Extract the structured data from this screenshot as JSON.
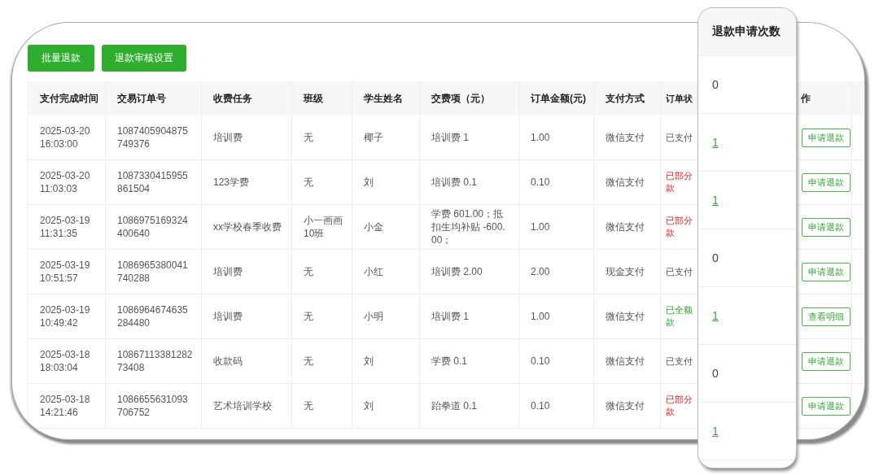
{
  "toolbar": {
    "buttons": [
      "批量退款",
      "退款审核设置"
    ]
  },
  "table": {
    "columns": [
      "支付完成时间",
      "交易订单号",
      "收费任务",
      "班级",
      "学生姓名",
      "交费项（元）",
      "订单金额(元)",
      "支付方式",
      "订单状",
      "作"
    ],
    "rows": [
      {
        "time": "2025-03-20 16:03:00",
        "order_no": "1087405904875749376",
        "task": "培训费",
        "class": "无",
        "student": "椰子",
        "items": "培训费 1",
        "amount": "1.00",
        "payment": "微信支付",
        "status": {
          "kind": "paid",
          "lines": [
            "已支付"
          ]
        },
        "action": "申请退款"
      },
      {
        "time": "2025-03-20 11:03:03",
        "order_no": "1087330415955861504",
        "task": "123学费",
        "class": "无",
        "student": "刘",
        "items": "培训费 0.1",
        "amount": "0.10",
        "payment": "微信支付",
        "status": {
          "kind": "partial",
          "lines": [
            "已部分",
            "款"
          ]
        },
        "action": "申请退款"
      },
      {
        "time": "2025-03-19 11:31:35",
        "order_no": "1086975169324400640",
        "task": "xx学校春季收费",
        "class": "小一画画10班",
        "student": "小金",
        "items": "学费 601.00；抵扣生均补贴 -600.00；",
        "amount": "1.00",
        "payment": "微信支付",
        "status": {
          "kind": "partial",
          "lines": [
            "已部分",
            "款"
          ]
        },
        "action": "申请退款"
      },
      {
        "time": "2025-03-19 10:51:57",
        "order_no": "1086965380041740288",
        "task": "培训费",
        "class": "无",
        "student": "小红",
        "items": "培训费 2.00",
        "amount": "2.00",
        "payment": "现金支付",
        "status": {
          "kind": "paid",
          "lines": [
            "已支付"
          ]
        },
        "action": "申请退款"
      },
      {
        "time": "2025-03-19 10:49:42",
        "order_no": "1086964674635284480",
        "task": "培训费",
        "class": "无",
        "student": "小明",
        "items": "培训费 1",
        "amount": "1.00",
        "payment": "微信支付",
        "status": {
          "kind": "refunded",
          "lines": [
            "已全额",
            "款"
          ]
        },
        "action": "查看明细"
      },
      {
        "time": "2025-03-18 18:03:04",
        "order_no": "1086711338128273408",
        "task": "收款码",
        "class": "无",
        "student": "刘",
        "items": "学费 0.1",
        "amount": "0.10",
        "payment": "微信支付",
        "status": {
          "kind": "paid",
          "lines": [
            "已支付"
          ]
        },
        "action": "申请退款"
      },
      {
        "time": "2025-03-18 14:21:46",
        "order_no": "1086655631093706752",
        "task": "艺术培训学校",
        "class": "无",
        "student": "刘",
        "items": "跆拳道 0.1",
        "amount": "0.10",
        "payment": "微信支付",
        "status": {
          "kind": "partial",
          "lines": [
            "已部分",
            "款"
          ]
        },
        "action": "申请退款"
      }
    ]
  },
  "zoom_panel": {
    "title": "退款申请次数",
    "values": [
      {
        "text": "0",
        "link": false
      },
      {
        "text": "1",
        "link": true
      },
      {
        "text": "1",
        "link": true
      },
      {
        "text": "0",
        "link": false
      },
      {
        "text": "1",
        "link": true
      },
      {
        "text": "0",
        "link": false
      },
      {
        "text": "1",
        "link": true
      }
    ]
  }
}
